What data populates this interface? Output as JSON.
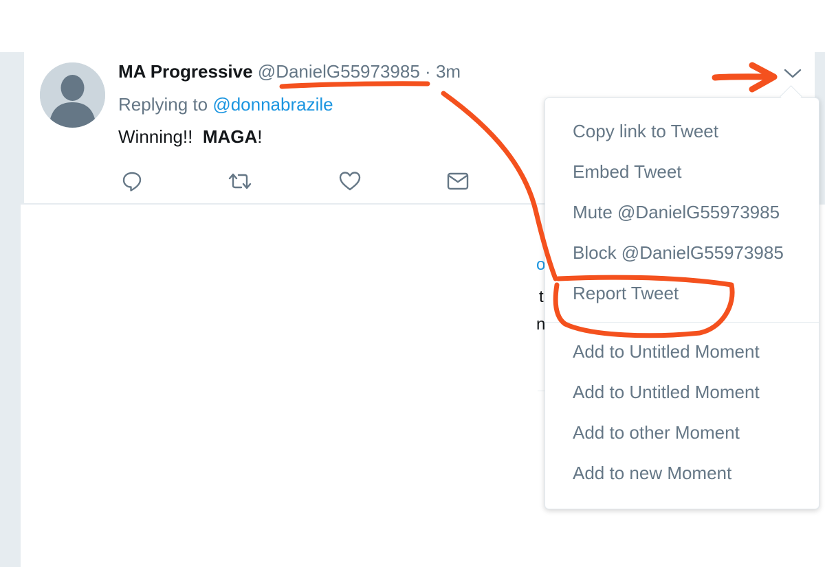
{
  "tweet": {
    "fullname": "MA Progressive",
    "username": "@DanielG55973985",
    "separator": "·",
    "timestamp": "3m",
    "replying_prefix": "Replying to",
    "replying_mention": "@donnabrazile",
    "text_plain": "Winning!!",
    "text_bold": "MAGA",
    "text_suffix": "!"
  },
  "actions": [
    {
      "name": "reply",
      "icon": "reply-icon"
    },
    {
      "name": "retweet",
      "icon": "retweet-icon"
    },
    {
      "name": "like",
      "icon": "heart-icon"
    },
    {
      "name": "direct-message",
      "icon": "envelope-icon"
    }
  ],
  "dropdown": {
    "items": [
      "Copy link to Tweet",
      "Embed Tweet",
      "Mute @DanielG55973985",
      "Block @DanielG55973985",
      "Report Tweet",
      "Add to Untitled Moment",
      "Add to Untitled Moment",
      "Add to other Moment",
      "Add to new Moment"
    ]
  },
  "background_fragments": [
    "o",
    "t",
    "n"
  ],
  "colors": {
    "accent": "#1b95e0",
    "secondary_text": "#657786",
    "annotation": "#f4511e",
    "page_bg": "#e6ecf0"
  }
}
